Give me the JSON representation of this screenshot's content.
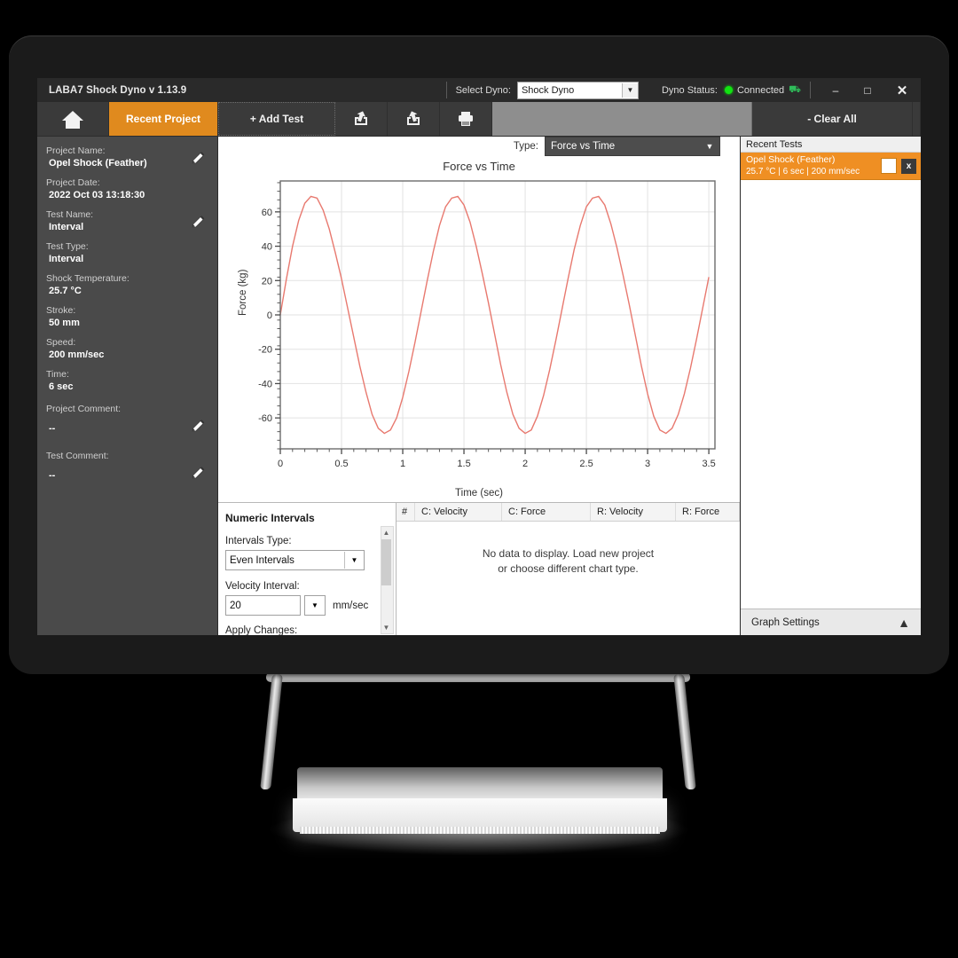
{
  "titlebar": {
    "app_title": "LABA7 Shock Dyno  v 1.13.9",
    "select_dyno_label": "Select Dyno:",
    "select_dyno_value": "Shock Dyno",
    "dyno_status_label": "Dyno Status:",
    "dyno_status_value": "Connected",
    "minimize": "–",
    "maximize": "□",
    "close": "✕"
  },
  "toolbar": {
    "home": "home-icon",
    "recent_project": "Recent Project",
    "add_test": "+ Add Test",
    "export_icon": "export-icon",
    "import_icon": "import-icon",
    "print_icon": "print-icon",
    "clear_all": "- Clear All"
  },
  "left_panel": {
    "fields": [
      {
        "label": "Project Name:",
        "value": "Opel Shock (Feather)",
        "editable": true
      },
      {
        "label": "Project Date:",
        "value": "2022 Oct 03 13:18:30",
        "editable": false
      },
      {
        "label": "Test Name:",
        "value": "Interval",
        "editable": true
      },
      {
        "label": "Test Type:",
        "value": "Interval",
        "editable": false
      },
      {
        "label": "Shock Temperature:",
        "value": "25.7 °C",
        "editable": false
      },
      {
        "label": "Stroke:",
        "value": "50  mm",
        "editable": false
      },
      {
        "label": "Speed:",
        "value": "200  mm/sec",
        "editable": false
      },
      {
        "label": "Time:",
        "value": "6 sec",
        "editable": false
      },
      {
        "label": "Project Comment:",
        "value": "--",
        "editable": true
      },
      {
        "label": "Test Comment:",
        "value": "--",
        "editable": true
      }
    ]
  },
  "chart_header": {
    "type_label": "Type:",
    "type_value": "Force vs Time"
  },
  "chart_data": {
    "type": "line",
    "title": "Force vs Time",
    "xlabel": "Time (sec)",
    "ylabel": "Force (kg)",
    "xlim": [
      0,
      3.55
    ],
    "ylim": [
      -78,
      78
    ],
    "xticks": [
      0,
      0.5,
      1,
      1.5,
      2,
      2.5,
      3,
      3.5
    ],
    "xtick_labels": [
      "0",
      "0.5",
      "1",
      "1.5",
      "2",
      "2.5",
      "3",
      "3.5"
    ],
    "yticks": [
      -60,
      -40,
      -20,
      0,
      20,
      40,
      60
    ],
    "ytick_labels": [
      "-60",
      "-40",
      "-20",
      "0",
      "20",
      "40",
      "60"
    ],
    "grid": true,
    "minor_ticks": true,
    "line_color": "#e8796f",
    "series": [
      {
        "name": "Force",
        "amplitude": 69,
        "period": 1.0,
        "phase_offset": 0.0,
        "x": [
          0,
          0.05,
          0.1,
          0.15,
          0.2,
          0.25,
          0.3,
          0.35,
          0.4,
          0.45,
          0.5,
          0.55,
          0.6,
          0.65,
          0.7,
          0.75,
          0.8,
          0.85,
          0.9,
          0.95,
          1.0,
          1.05,
          1.1,
          1.15,
          1.2,
          1.25,
          1.3,
          1.35,
          1.4,
          1.45,
          1.5,
          1.55,
          1.6,
          1.65,
          1.7,
          1.75,
          1.8,
          1.85,
          1.9,
          1.95,
          2.0,
          2.05,
          2.1,
          2.15,
          2.2,
          2.25,
          2.3,
          2.35,
          2.4,
          2.45,
          2.5,
          2.55,
          2.6,
          2.65,
          2.7,
          2.75,
          2.8,
          2.85,
          2.9,
          2.95,
          3.0,
          3.05,
          3.1,
          3.15,
          3.2,
          3.25,
          3.3,
          3.35,
          3.4,
          3.45,
          3.5
        ],
        "y": [
          0,
          21,
          40,
          55,
          65,
          69,
          68,
          61,
          50,
          36,
          21,
          4,
          -13,
          -30,
          -45,
          -58,
          -66,
          -69,
          -67,
          -60,
          -48,
          -33,
          -16,
          2,
          20,
          37,
          52,
          63,
          68,
          69,
          64,
          54,
          40,
          24,
          7,
          -11,
          -29,
          -45,
          -58,
          -66,
          -69,
          -67,
          -59,
          -47,
          -32,
          -15,
          3,
          21,
          38,
          52,
          63,
          68,
          69,
          64,
          53,
          39,
          23,
          6,
          -12,
          -30,
          -46,
          -59,
          -67,
          -69,
          -66,
          -58,
          -46,
          -31,
          -14,
          4,
          22
        ]
      }
    ]
  },
  "intervals_panel": {
    "title": "Numeric Intervals",
    "intervals_type_label": "Intervals Type:",
    "intervals_type_value": "Even Intervals",
    "velocity_interval_label": "Velocity Interval:",
    "velocity_interval_value": "20",
    "velocity_unit": "mm/sec",
    "apply_changes_label": "Apply Changes:"
  },
  "data_table": {
    "columns": [
      "#",
      "C: Velocity",
      "C: Force",
      "R: Velocity",
      "R: Force"
    ],
    "empty_message_line1": "No data to display. Load new project",
    "empty_message_line2": "or choose different chart type.",
    "rows": []
  },
  "right_panel": {
    "header": "Recent Tests",
    "tests": [
      {
        "name": "Opel Shock (Feather)",
        "meta": "25.7 °C | 6 sec | 200 mm/sec",
        "checked": false,
        "close_label": "x"
      }
    ],
    "graph_settings_label": "Graph Settings",
    "graph_settings_caret": "▲"
  },
  "colors": {
    "accent_orange": "#e08a1e",
    "test_row_orange": "#ef8f23",
    "chart_line": "#e8796f",
    "titlebar_bg": "#2a2a2a",
    "toolbar_bg": "#3a3a3a",
    "left_panel_bg": "#4a4a4a",
    "connected_green": "#12e212"
  }
}
